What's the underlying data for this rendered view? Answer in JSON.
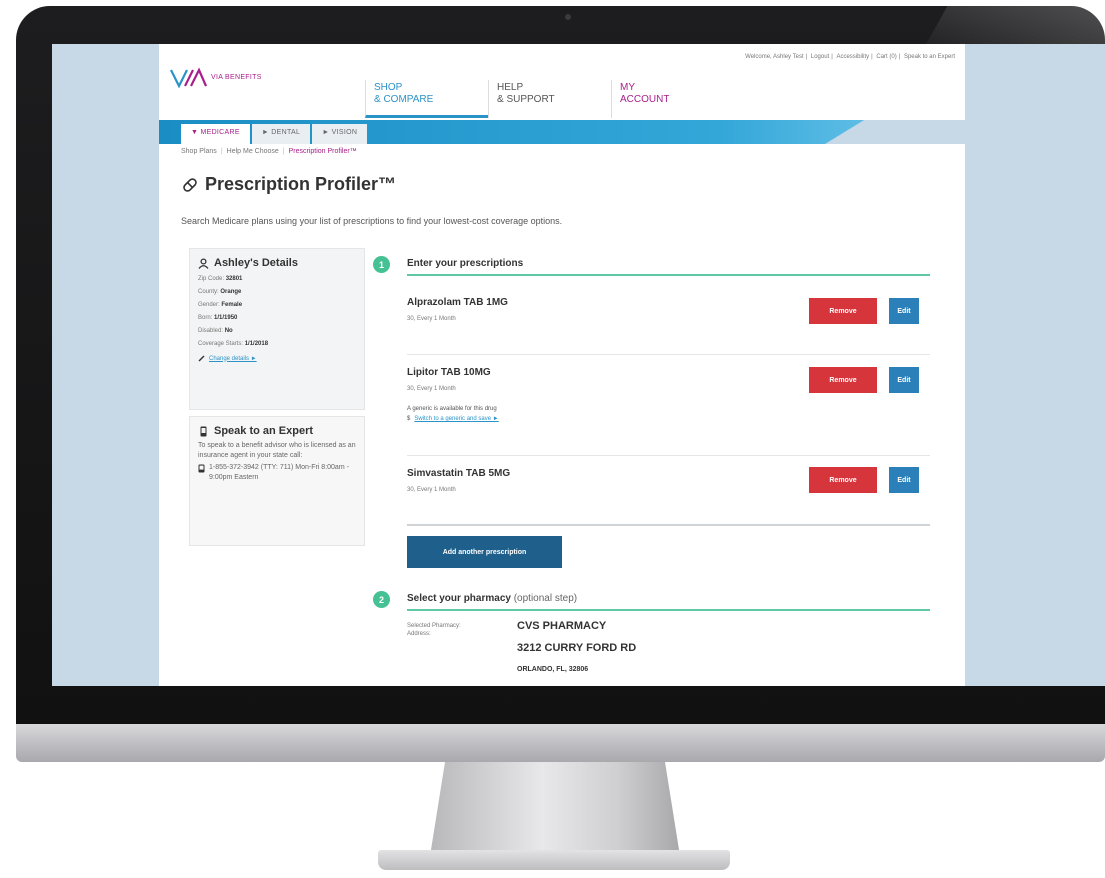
{
  "header": {
    "logo_text": "VIA BENEFITS",
    "utility_links": [
      "Welcome, Ashley Test",
      "Logout",
      "Accessibility",
      "Cart (0)",
      "Speak to an Expert"
    ],
    "nav": [
      {
        "line1": "SHOP",
        "line2": "& COMPARE"
      },
      {
        "line1": "HELP",
        "line2": "& SUPPORT"
      },
      {
        "line1": "MY",
        "line2": "ACCOUNT"
      }
    ]
  },
  "sub_tabs": [
    "▼ MEDICARE",
    "► DENTAL",
    "► VISION"
  ],
  "breadcrumb": [
    "Shop Plans",
    "Help Me Choose",
    "Prescription Profiler™"
  ],
  "page_title": "Prescription Profiler™",
  "intro": "Search Medicare plans using your list of prescriptions to find your lowest-cost coverage options.",
  "details": {
    "title": "Ashley's Details",
    "rows": [
      {
        "label": "Zip Code:",
        "value": "32801"
      },
      {
        "label": "County:",
        "value": "Orange"
      },
      {
        "label": "Gender:",
        "value": "Female"
      },
      {
        "label": "Born:",
        "value": "1/1/1950"
      },
      {
        "label": "Disabled:",
        "value": "No"
      },
      {
        "label": "Coverage Starts:",
        "value": "1/1/2018"
      }
    ],
    "change_link": "Change details ►"
  },
  "expert": {
    "title": "Speak to an Expert",
    "text": "To speak to a benefit advisor who is licensed as an insurance agent in your state call:",
    "phone": "1-855-372-3942 (TTY: 711) Mon-Fri 8:00am - 9:00pm Eastern"
  },
  "step1": {
    "number": "1",
    "title": "Enter your prescriptions",
    "prescriptions": [
      {
        "name": "Alprazolam TAB 1MG",
        "freq": "30, Every 1 Month"
      },
      {
        "name": "Lipitor TAB 10MG",
        "freq": "30, Every 1 Month",
        "generic_note": "A generic is available for this drug",
        "generic_link": "Switch to a generic and save ►"
      },
      {
        "name": "Simvastatin TAB 5MG",
        "freq": "30, Every 1 Month"
      }
    ],
    "remove_label": "Remove",
    "edit_label": "Edit",
    "add_label": "Add another prescription"
  },
  "step2": {
    "number": "2",
    "title": "Select your pharmacy",
    "optional": "(optional step)",
    "selected_label": "Selected Pharmacy:",
    "address_label": "Address:",
    "pharmacy_name": "CVS PHARMACY",
    "street": "3212 CURRY FORD RD",
    "city": "ORLANDO, FL, 32806"
  },
  "icons": {
    "dollar": "$"
  },
  "colors": {
    "brand_purple": "#a7208a",
    "nav_blue": "#2a93c8",
    "remove_red": "#d6353b",
    "edit_blue": "#2c80b9",
    "step_green": "#45c194"
  }
}
